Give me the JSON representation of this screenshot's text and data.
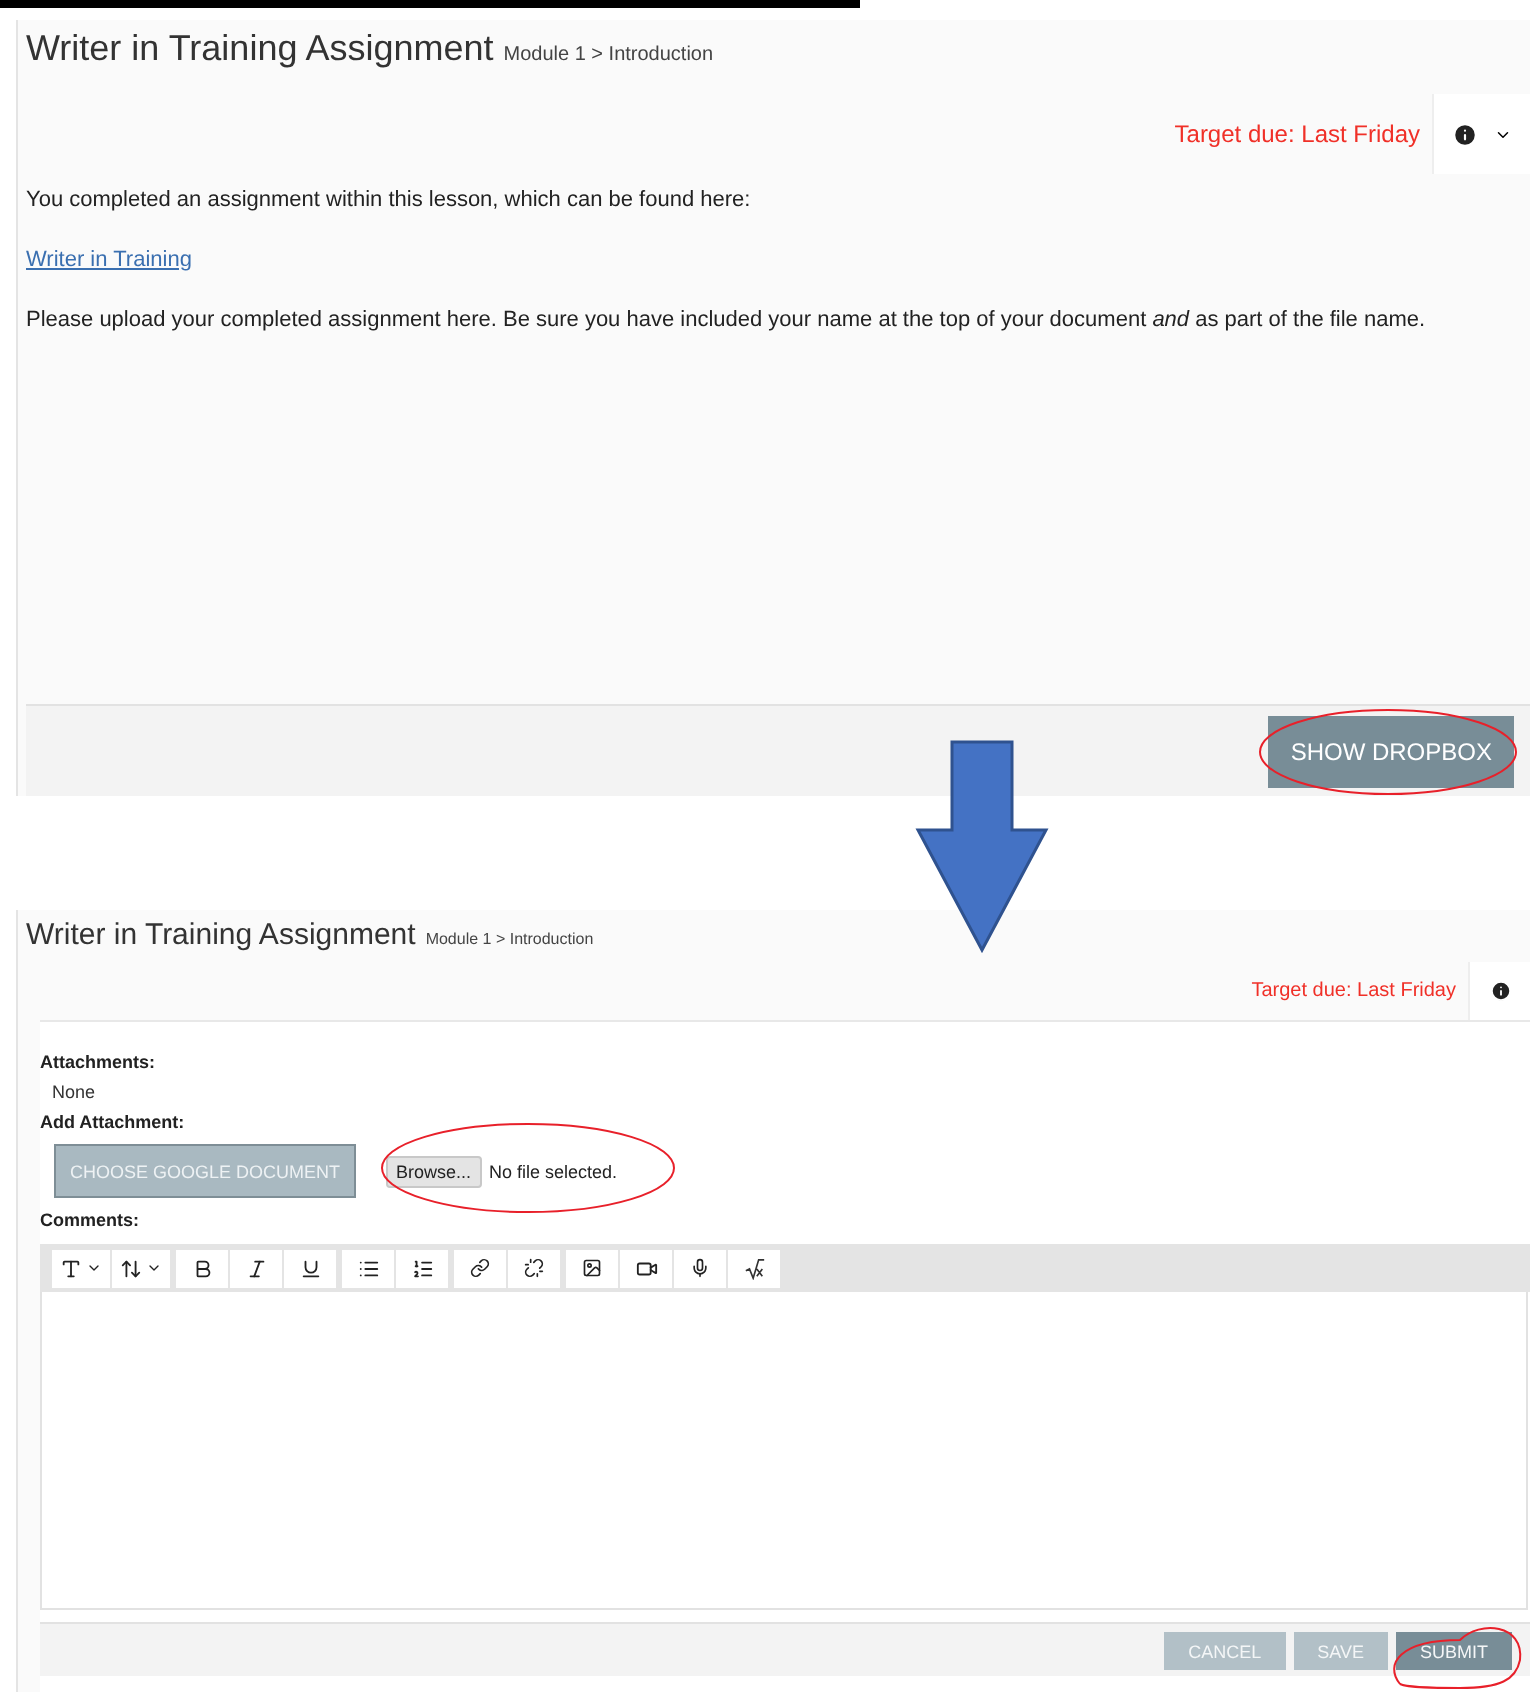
{
  "before": {
    "title": "Writer in Training Assignment",
    "breadcrumb": "Module 1 > Introduction",
    "target_due": "Target due: Last Friday",
    "paragraphs": [
      {
        "kind": "text",
        "text": "You completed an assignment within this lesson, which can be found here:"
      },
      {
        "kind": "link",
        "text": "Writer in Training"
      },
      {
        "kind": "text",
        "text": "Please upload your completed assignment here. Be sure you have included your name at the top of your document *and* as part of the file name."
      }
    ],
    "button": "SHOW DROPBOX"
  },
  "after": {
    "title": "Writer in Training Assignment",
    "breadcrumb": "Module 1 > Introduction",
    "target_due": "Target due: Last Friday",
    "attachments_label": "Attachments:",
    "attachments_value": "None",
    "add_attachment_label": "Add Attachment:",
    "google_button": "CHOOSE GOOGLE DOCUMENT",
    "browse_button": "Browse...",
    "file_status": "No file selected.",
    "comments_label": "Comments:",
    "buttons": [
      {
        "label": "CANCEL",
        "disabled": true
      },
      {
        "label": "SAVE",
        "disabled": true
      },
      {
        "label": "SUBMIT",
        "disabled": false
      }
    ]
  }
}
